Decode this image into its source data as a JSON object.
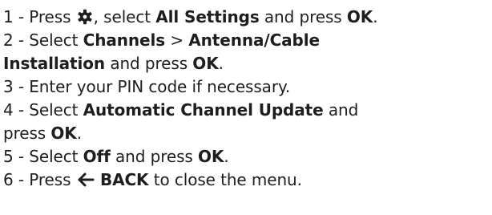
{
  "steps": [
    {
      "number": "1 -",
      "pre": "Press",
      "icon": "gear-icon",
      "mid": ", select",
      "bold1": "All Settings",
      "post": "and press",
      "bold2": "OK",
      "end": "."
    },
    {
      "number": "2 -",
      "pre": "Select",
      "bold1": "Channels",
      "sep": ">",
      "bold2": "Antenna/Cable",
      "bold3": "Installation",
      "post": "and press",
      "bold4": "OK",
      "end": "."
    },
    {
      "number": "3 -",
      "text": "Enter your PIN code if necessary."
    },
    {
      "number": "4 -",
      "pre": "Select",
      "bold1": "Automatic Channel Update",
      "post": "and",
      "cont": "press",
      "bold2": "OK",
      "end": "."
    },
    {
      "number": "5 -",
      "pre": "Select",
      "bold1": "Off",
      "post": "and press",
      "bold2": "OK",
      "end": "."
    },
    {
      "number": "6 -",
      "pre": "Press",
      "icon": "back-arrow-icon",
      "bold1": "BACK",
      "post": "to close the menu."
    }
  ],
  "colors": {
    "text": "#1e1e1e"
  }
}
